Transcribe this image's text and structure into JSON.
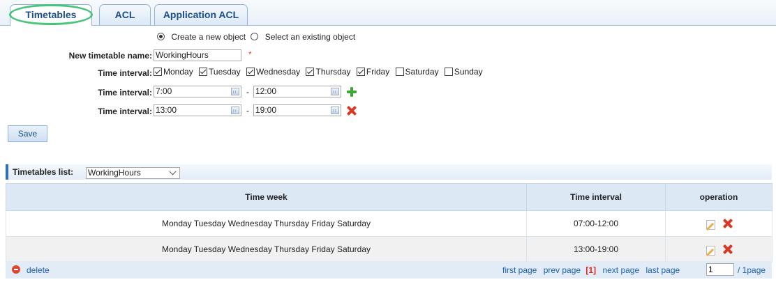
{
  "tabs": [
    {
      "label": "Timetables",
      "active": true
    },
    {
      "label": "ACL",
      "active": false
    },
    {
      "label": "Application ACL",
      "active": false
    }
  ],
  "form": {
    "mode_options": [
      {
        "label": "Create a new object",
        "selected": true
      },
      {
        "label": "Select an existing object",
        "selected": false
      }
    ],
    "name_label": "New timetable name:",
    "name_value": "WorkingHours",
    "required_mark": "*",
    "days_label": "Time interval:",
    "days": [
      {
        "label": "Monday",
        "checked": true
      },
      {
        "label": "Tuesday",
        "checked": true
      },
      {
        "label": "Wednesday",
        "checked": true
      },
      {
        "label": "Thursday",
        "checked": true
      },
      {
        "label": "Friday",
        "checked": true
      },
      {
        "label": "Saturday",
        "checked": false
      },
      {
        "label": "Sunday",
        "checked": false
      }
    ],
    "intervals": [
      {
        "label": "Time interval:",
        "start": "7:00",
        "end": "12:00",
        "action": "add-icon"
      },
      {
        "label": "Time interval:",
        "start": "13:00",
        "end": "19:00",
        "action": "remove-icon"
      }
    ],
    "separator": "-",
    "save_label": "Save"
  },
  "list": {
    "title": "Timetables list:",
    "selected": "WorkingHours",
    "columns": [
      "Time week",
      "Time interval",
      "operation"
    ],
    "rows": [
      {
        "week": "Monday Tuesday Wednesday Thursday Friday Saturday",
        "interval": "07:00-12:00"
      },
      {
        "week": "Monday Tuesday Wednesday Thursday Friday Saturday",
        "interval": "13:00-19:00"
      }
    ]
  },
  "footer": {
    "delete_label": "delete",
    "first": "first page",
    "prev": "prev page",
    "current": "[1]",
    "next": "next page",
    "last": "last page",
    "page_value": "1",
    "total": "/ 1page"
  },
  "colors": {
    "accent": "#1c4d86",
    "highlight_ring": "#49c47a",
    "danger": "#d63a24",
    "add": "#3fa73a"
  }
}
